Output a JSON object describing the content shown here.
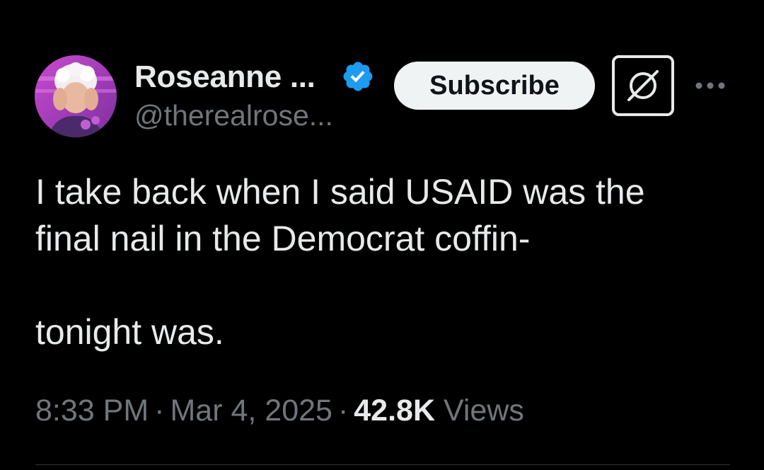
{
  "author": {
    "display_name": "Roseanne ...",
    "handle": "@therealrose...",
    "verified_icon": "verified-badge-icon",
    "verified_color": "#1d9bf0"
  },
  "actions": {
    "subscribe_label": "Subscribe",
    "grok_icon": "grok-icon",
    "more_icon": "more-options-icon"
  },
  "tweet": {
    "text": "I take back when I said USAID was the\nfinal nail in the Democrat coffin-\n\ntonight was."
  },
  "meta": {
    "time": "8:33 PM",
    "separator": "·",
    "date": "Mar 4, 2025",
    "views_count": "42.8K",
    "views_label": "Views"
  },
  "colors": {
    "background": "#000000",
    "primary_text": "#e7e9ea",
    "secondary_text": "#71767b",
    "button_bg": "#eff3f4",
    "divider": "#2f3336"
  }
}
